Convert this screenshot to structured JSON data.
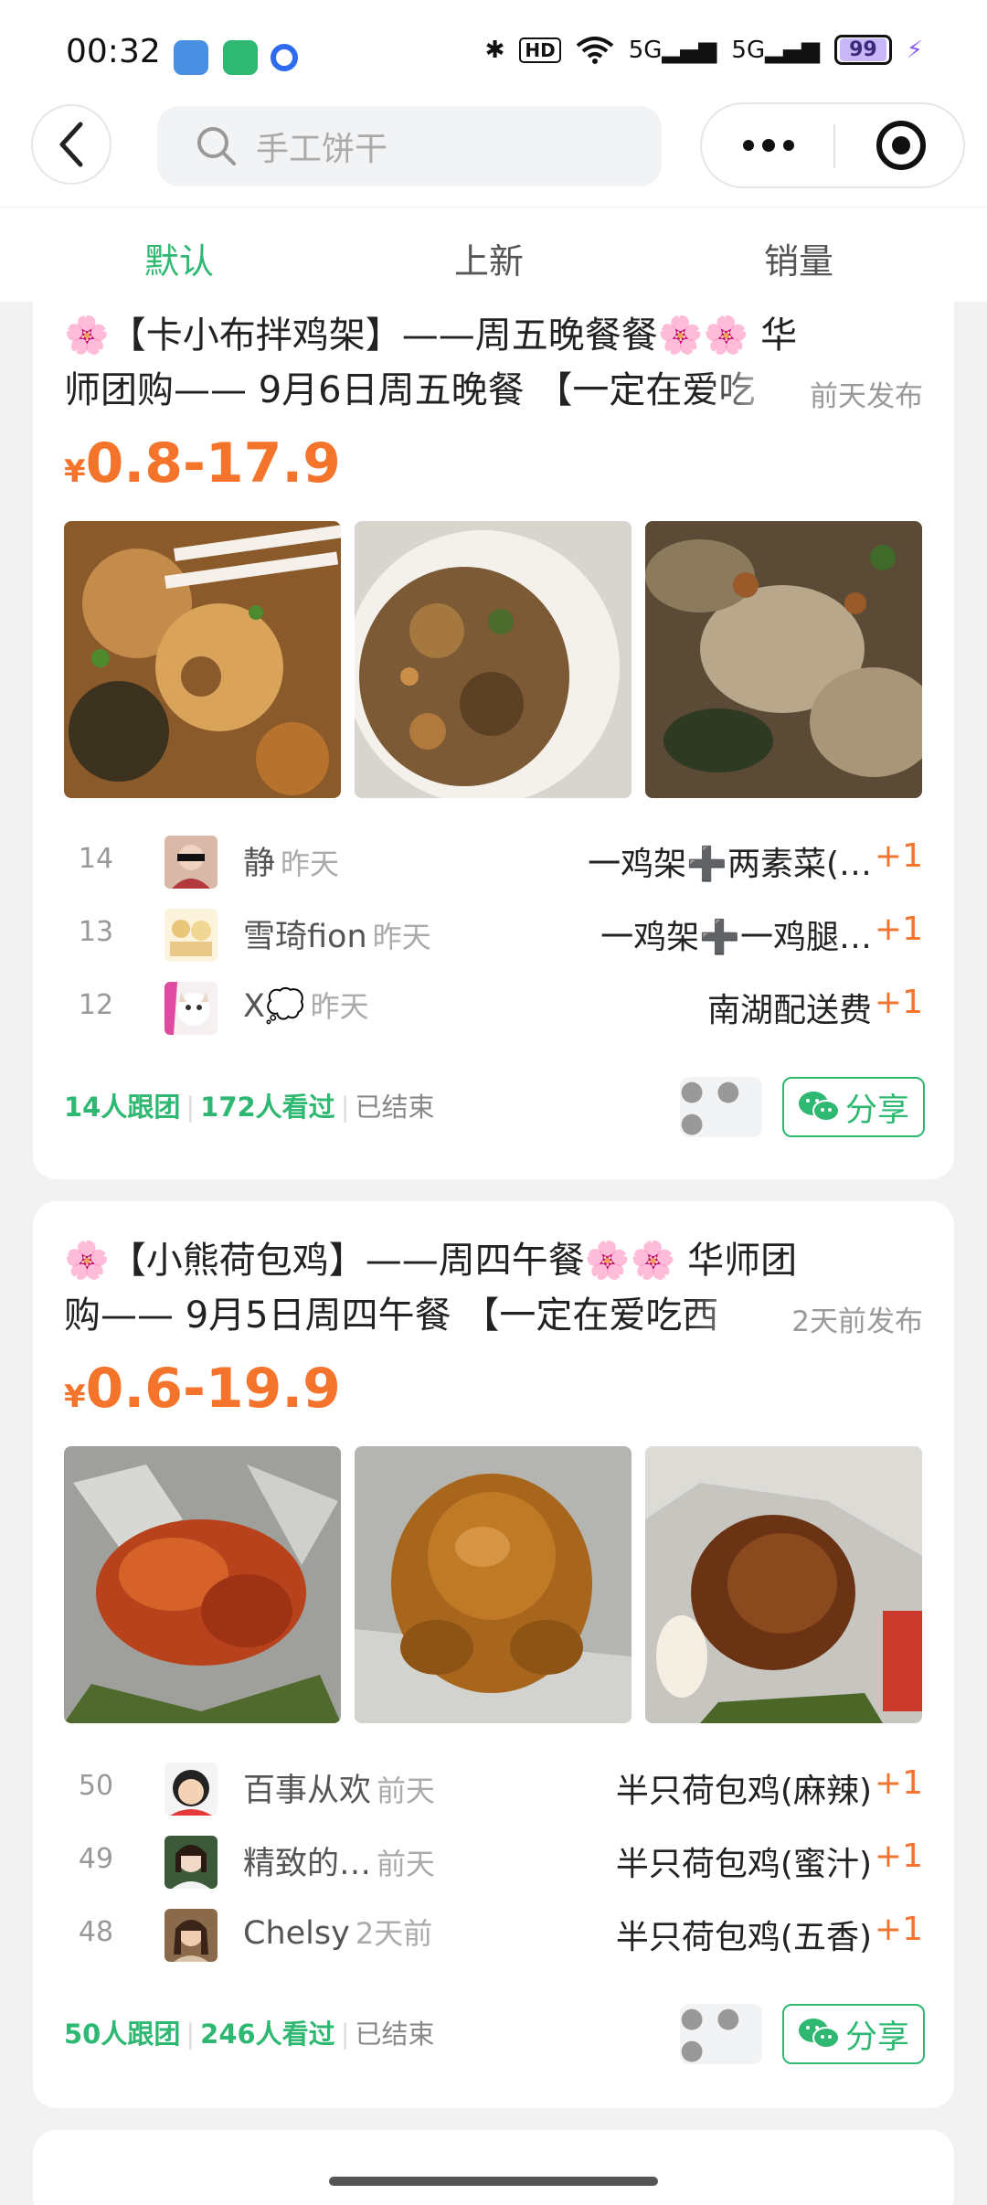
{
  "status_bar": {
    "time": "00:32",
    "network": "5G",
    "battery": "99"
  },
  "search": {
    "placeholder": "手工饼干"
  },
  "tabs": [
    {
      "label": "默认",
      "active": true
    },
    {
      "label": "上新",
      "active": false
    },
    {
      "label": "销量",
      "active": false
    }
  ],
  "posts": [
    {
      "title_line1": "🌸【卡小布拌鸡架】——周五晚餐餐🌸🌸 华",
      "title_line2": "师团购—— 9月6日周五晚餐 【一定在爱吃",
      "posted": "前天发布",
      "price_symbol": "¥",
      "price": "0.8-17.9",
      "buyers": [
        {
          "num": "14",
          "name": "静",
          "time": "昨天",
          "item": "一鸡架➕两素菜(…",
          "qty": "+1"
        },
        {
          "num": "13",
          "name": "雪琦fion",
          "time": "昨天",
          "item": "一鸡架➕一鸡腿…",
          "qty": "+1"
        },
        {
          "num": "12",
          "name": "X💭",
          "time": "昨天",
          "item": "南湖配送费",
          "qty": "+1"
        }
      ],
      "stats": {
        "joined": "14人跟团",
        "viewed": "172人看过",
        "status": "已结束"
      },
      "share_label": "分享"
    },
    {
      "title_line1": "🌸【小熊荷包鸡】——周四午餐🌸🌸 华师团",
      "title_line2": "购—— 9月5日周四午餐 【一定在爱吃西",
      "posted": "2天前发布",
      "price_symbol": "¥",
      "price": "0.6-19.9",
      "buyers": [
        {
          "num": "50",
          "name": "百事从欢",
          "time": "前天",
          "item": "半只荷包鸡(麻辣)",
          "qty": "+1"
        },
        {
          "num": "49",
          "name": "精致的…",
          "time": "前天",
          "item": "半只荷包鸡(蜜汁)",
          "qty": "+1"
        },
        {
          "num": "48",
          "name": "Chelsy",
          "time": "2天前",
          "item": "半只荷包鸡(五香)",
          "qty": "+1"
        }
      ],
      "stats": {
        "joined": "50人跟团",
        "viewed": "246人看过",
        "status": "已结束"
      },
      "share_label": "分享"
    }
  ],
  "colors": {
    "accent_green": "#2eb872",
    "price_orange": "#f4742b"
  }
}
